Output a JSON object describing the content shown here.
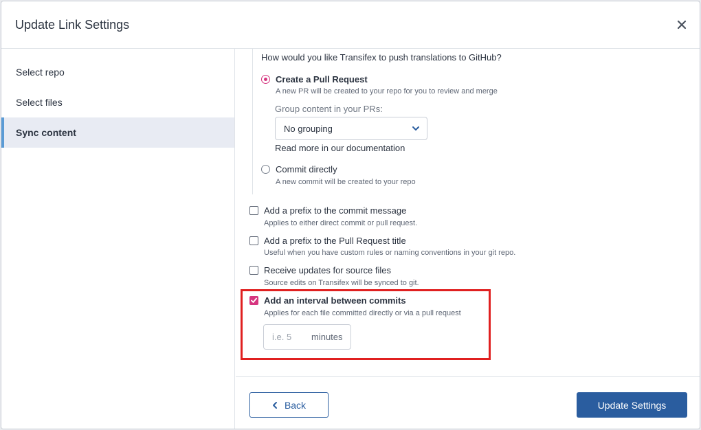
{
  "dialog": {
    "title": "Update Link Settings"
  },
  "sidebar": {
    "items": [
      {
        "label": "Select repo"
      },
      {
        "label": "Select files"
      },
      {
        "label": "Sync content",
        "active": true
      }
    ]
  },
  "push": {
    "question": "How would you like Transifex to push translations to GitHub?",
    "pull_request": {
      "label": "Create a Pull Request",
      "desc": "A new PR will be created to your repo for you to review and merge",
      "selected": true
    },
    "group_label": "Group content in your PRs:",
    "group_select": "No grouping",
    "doc_link": "Read more in our documentation",
    "commit_directly": {
      "label": "Commit directly",
      "desc": "A new commit will be created to your repo",
      "selected": false
    }
  },
  "options": [
    {
      "label": "Add a prefix to the commit message",
      "desc": "Applies to either direct commit or pull request.",
      "checked": false
    },
    {
      "label": "Add a prefix to the Pull Request title",
      "desc": "Useful when you have custom rules or naming conventions in your git repo.",
      "checked": false
    },
    {
      "label": "Receive updates for source files",
      "desc": "Source edits on Transifex will be synced to git.",
      "checked": false
    },
    {
      "label": "Add an interval between commits",
      "desc": "Applies for each file committed directly or via a pull request",
      "checked": true
    }
  ],
  "interval": {
    "placeholder": "i.e. 5",
    "unit": "minutes"
  },
  "footer": {
    "back_label": "Back",
    "update_label": "Update Settings"
  },
  "colors": {
    "accent": "#d6357f",
    "primary": "#2a5d9f",
    "highlight": "#e02020",
    "active_indicator": "#5b9bd5"
  }
}
